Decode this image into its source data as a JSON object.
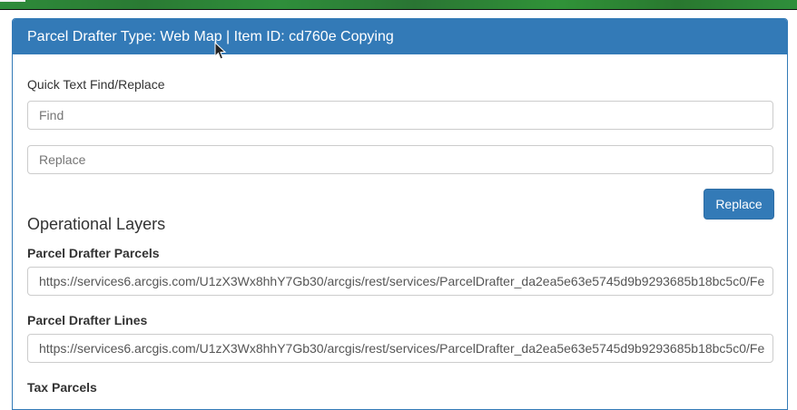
{
  "header": {
    "title": "Parcel Drafter Type: Web Map | Item ID: cd760e Copying"
  },
  "find_replace": {
    "label": "Quick Text Find/Replace",
    "find_placeholder": "Find",
    "replace_placeholder": "Replace",
    "replace_button": "Replace"
  },
  "operational_layers": {
    "heading": "Operational Layers",
    "layers": [
      {
        "name": "Parcel Drafter Parcels",
        "url": "https://services6.arcgis.com/U1zX3Wx8hhY7Gb30/arcgis/rest/services/ParcelDrafter_da2ea5e63e5745d9b9293685b18bc5c0/Fe"
      },
      {
        "name": "Parcel Drafter Lines",
        "url": "https://services6.arcgis.com/U1zX3Wx8hhY7Gb30/arcgis/rest/services/ParcelDrafter_da2ea5e63e5745d9b9293685b18bc5c0/Fe"
      },
      {
        "name": "Tax Parcels"
      }
    ]
  }
}
